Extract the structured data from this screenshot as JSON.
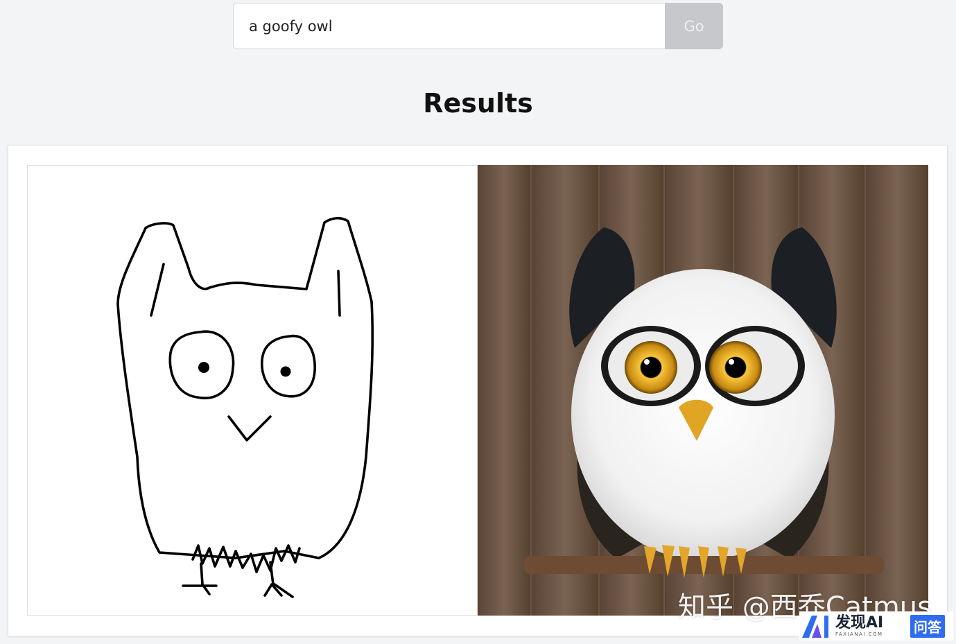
{
  "search": {
    "value": "a goofy owl",
    "button_label": "Go"
  },
  "results": {
    "heading": "Results",
    "images": [
      {
        "kind": "input-sketch",
        "subject": "hand-drawn owl line sketch"
      },
      {
        "kind": "generated-image",
        "subject": "fluffy white and black owl perched on a branch against wooden planks"
      }
    ]
  },
  "watermark": {
    "text": "知乎 @西乔Catmus"
  },
  "brand": {
    "name": "发现AI",
    "domain": "FAXIANAI.COM",
    "tag": "问答"
  },
  "colors": {
    "page_bg": "#f3f4f6",
    "button_bg": "#c7c8cb",
    "brand_blue": "#2f6cf0"
  }
}
